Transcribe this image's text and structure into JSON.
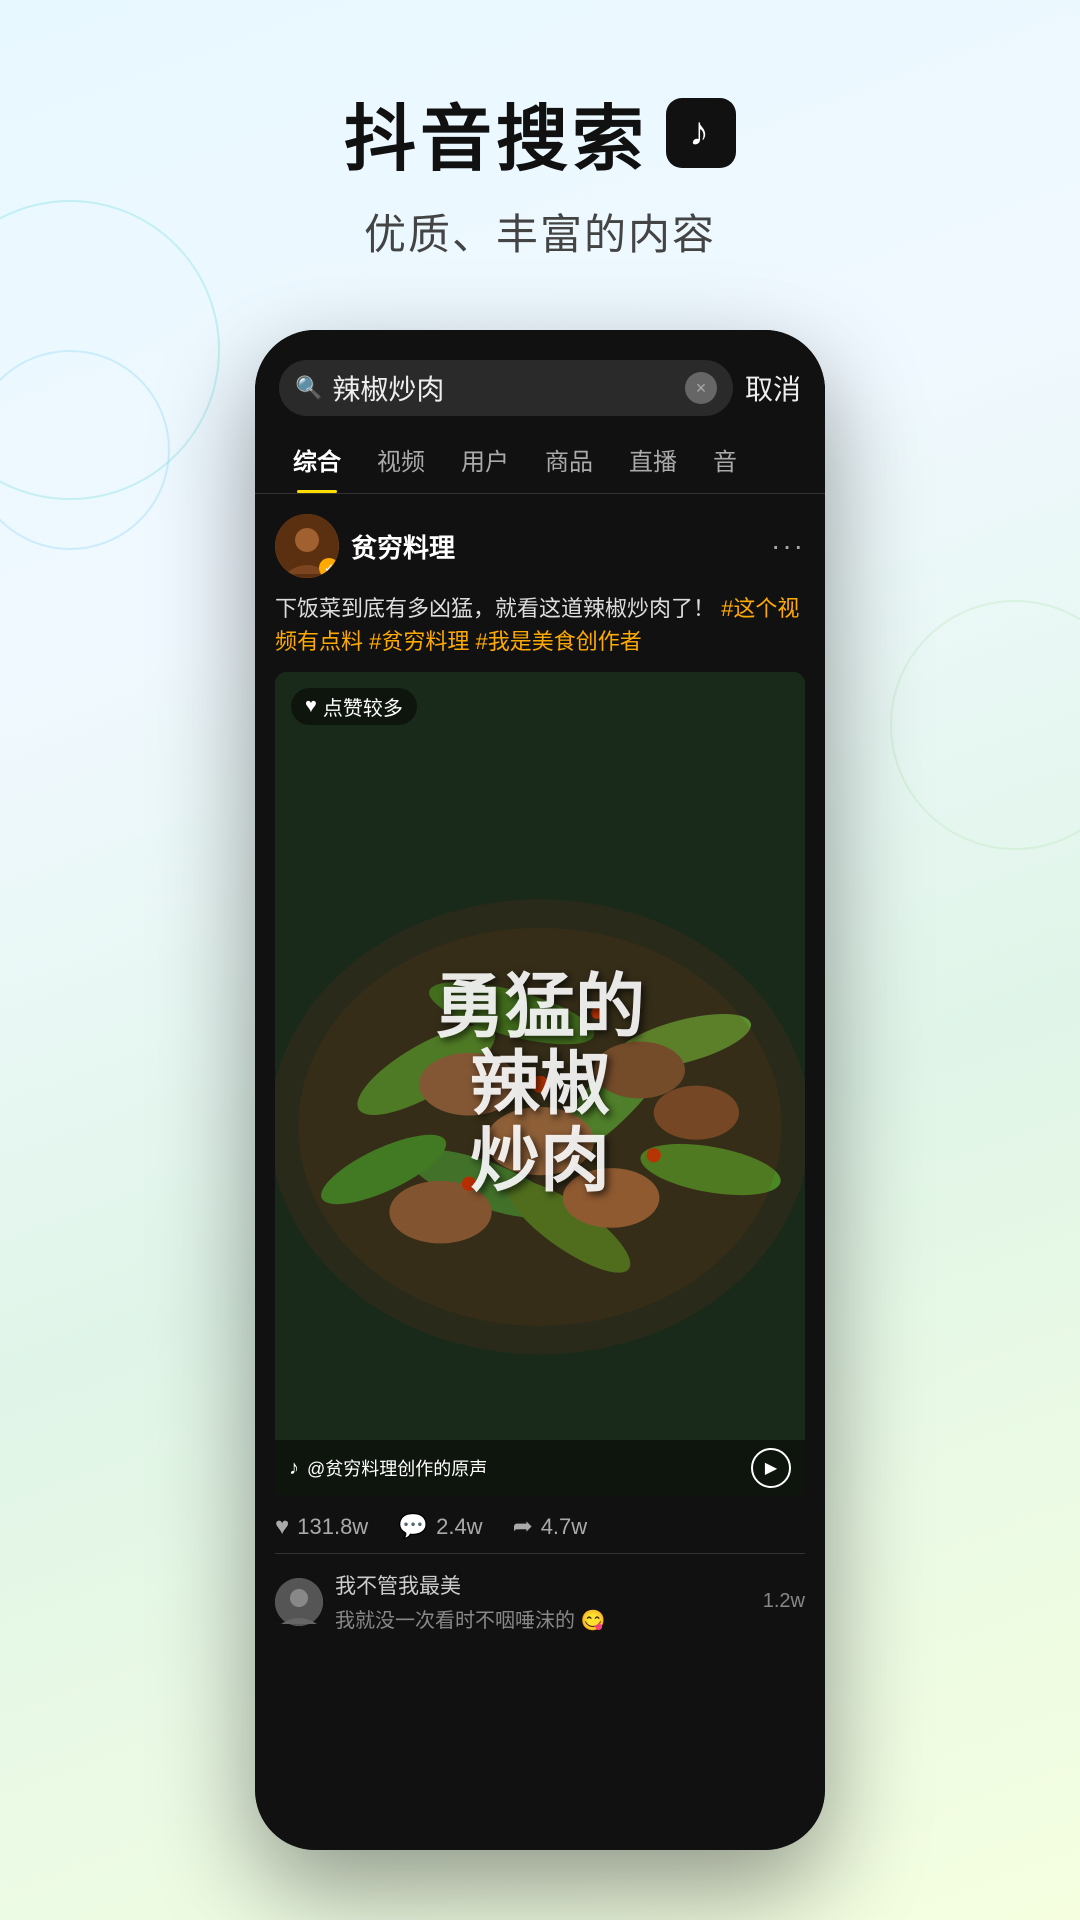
{
  "app": {
    "title": "抖音搜索",
    "tiktok_symbol": "♪",
    "subtitle": "优质、丰富的内容"
  },
  "search": {
    "placeholder": "辣椒炒肉",
    "query": "辣椒炒肉",
    "cancel_label": "取消",
    "clear_icon": "×"
  },
  "tabs": [
    {
      "label": "综合",
      "active": true
    },
    {
      "label": "视频",
      "active": false
    },
    {
      "label": "用户",
      "active": false
    },
    {
      "label": "商品",
      "active": false
    },
    {
      "label": "直播",
      "active": false
    },
    {
      "label": "音",
      "active": false
    }
  ],
  "post": {
    "user_name": "贫穷料理",
    "verified": true,
    "more_icon": "···",
    "text": "下饭菜到底有多凶猛，就看这道辣椒炒肉了！",
    "hashtags": [
      "#这个视频有点料",
      "#贫穷料理",
      "#我是美食创作者"
    ],
    "likes_badge": "点赞较多",
    "video_title": "勇猛的辣椒炒肉",
    "overlay_text": "勇\n猛\n的\n辣\n椒\n炒\n肉",
    "audio_label": "@贫穷料理创作的原声",
    "stats": {
      "likes": "131.8w",
      "comments": "2.4w",
      "shares": "4.7w"
    }
  },
  "comment": {
    "user": "我不管我最美",
    "text": "我就没一次看时不咽唾沫的 😋",
    "count_label": "1.2w"
  },
  "icons": {
    "search": "🔍",
    "heart": "♥",
    "comment": "💬",
    "share": "➦",
    "play": "▶",
    "tiktok": "♪"
  }
}
